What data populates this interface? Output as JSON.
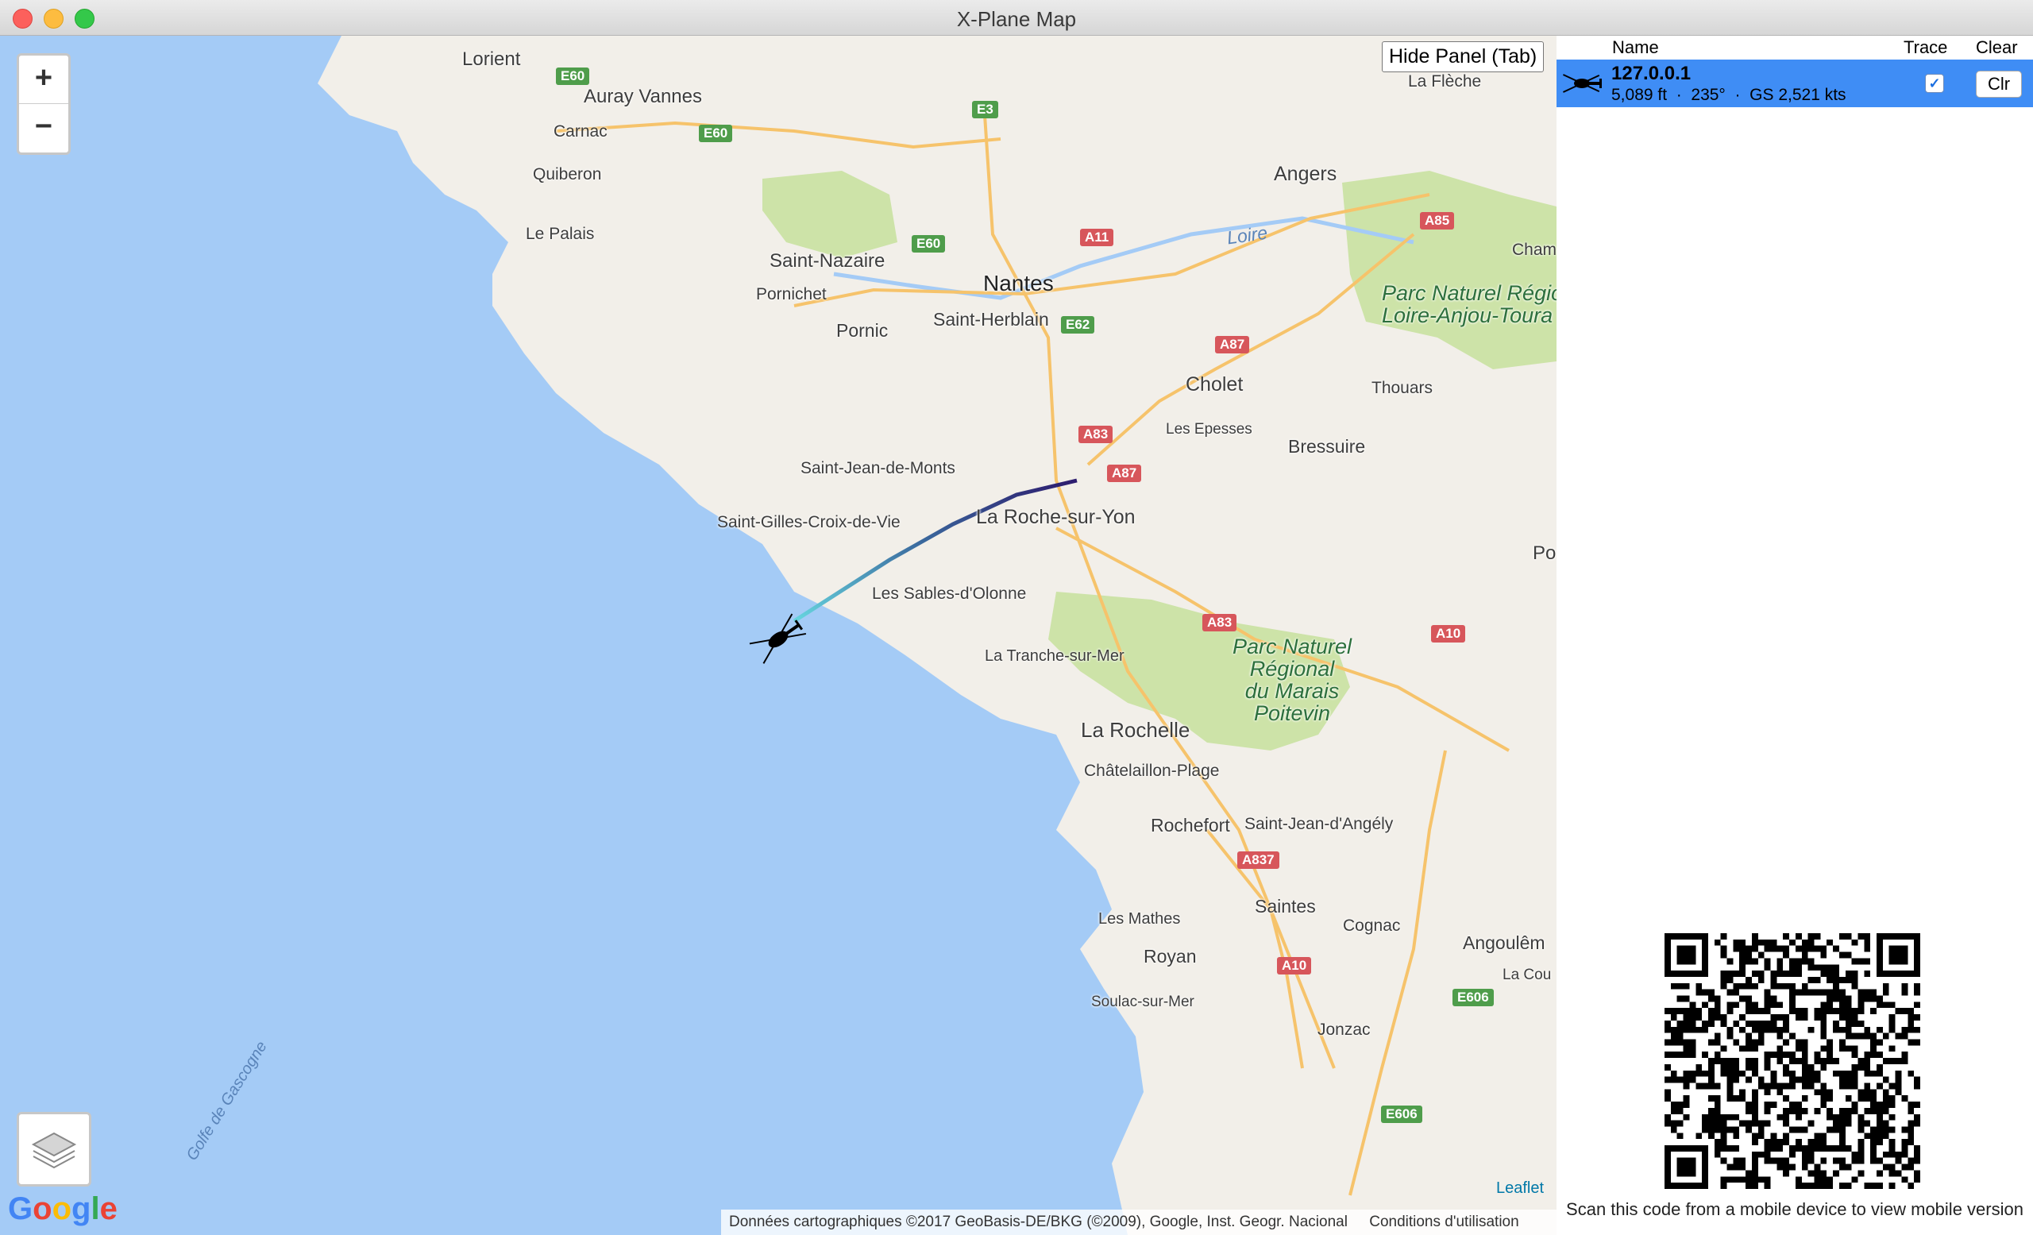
{
  "window": {
    "title": "X-Plane Map"
  },
  "map": {
    "zoom_in": "+",
    "zoom_out": "−",
    "hide_panel": "Hide Panel (Tab)",
    "places": {
      "lorient": "Lorient",
      "auray_vannes": "Auray Vannes",
      "carnac": "Carnac",
      "quiberon": "Quiberon",
      "le_palais": "Le Palais",
      "saint_nazaire": "Saint-Nazaire",
      "pornichet": "Pornichet",
      "pornic": "Pornic",
      "nantes": "Nantes",
      "saint_herblain": "Saint-Herblain",
      "angers": "Angers",
      "la_fleche": "La Flèche",
      "cholet": "Cholet",
      "thouars": "Thouars",
      "les_epesses": "Les Epesses",
      "bressuire": "Bressuire",
      "saint_jean_de_monts": "Saint-Jean-de-Monts",
      "saint_gilles": "Saint-Gilles-Croix-de-Vie",
      "la_roche": "La Roche-sur-Yon",
      "les_sables": "Les Sables-d'Olonne",
      "la_tranche": "La Tranche-sur-Mer",
      "la_rochelle": "La Rochelle",
      "chatelaillon": "Châtelaillon-Plage",
      "rochefort": "Rochefort",
      "saint_jean_angely": "Saint-Jean-d'Angély",
      "saintes": "Saintes",
      "cognac": "Cognac",
      "angouleme": "Angoulêm",
      "la_cou": "La Cou",
      "les_mathes": "Les Mathes",
      "royan": "Royan",
      "soulac": "Soulac-sur-Mer",
      "jonzac": "Jonzac",
      "cham": "Cham",
      "po": "Po",
      "loire": "Loire",
      "golfe": "Golfe de Gascogne",
      "park_loire": "Parc Naturel Régio\nLoire-Anjou-Toura",
      "park_marais": "Parc Naturel\nRégional\ndu Marais\nPoitevin"
    },
    "roads": {
      "e60a": "E60",
      "e60b": "E60",
      "e60c": "E60",
      "e3": "E3",
      "a11": "A11",
      "e62": "E62",
      "a87a": "A87",
      "a83a": "A83",
      "a87b": "A87",
      "a83b": "A83",
      "a10a": "A10",
      "a85": "A85",
      "a837": "A837",
      "a10b": "A10",
      "e606a": "E606",
      "e606b": "E606"
    },
    "google": "Google",
    "leaflet": "Leaflet",
    "attribution": "Données cartographiques ©2017 GeoBasis-DE/BKG (©2009), Google, Inst. Geogr. Nacional",
    "terms": "Conditions d'utilisation"
  },
  "panel": {
    "headers": {
      "name": "Name",
      "trace": "Trace",
      "clear": "Clear"
    },
    "aircraft": {
      "name": "127.0.0.1",
      "info": "5,089 ft  ·  235°  ·  GS 2,521 kts",
      "trace_checked": true,
      "clear_label": "Clr"
    },
    "qr_note": "Scan this code from a mobile device to view mobile version"
  },
  "colors": {
    "water": "#a4cbf6",
    "land": "#f2efe9",
    "park": "#cde3a8",
    "selection": "#3f8df5"
  }
}
